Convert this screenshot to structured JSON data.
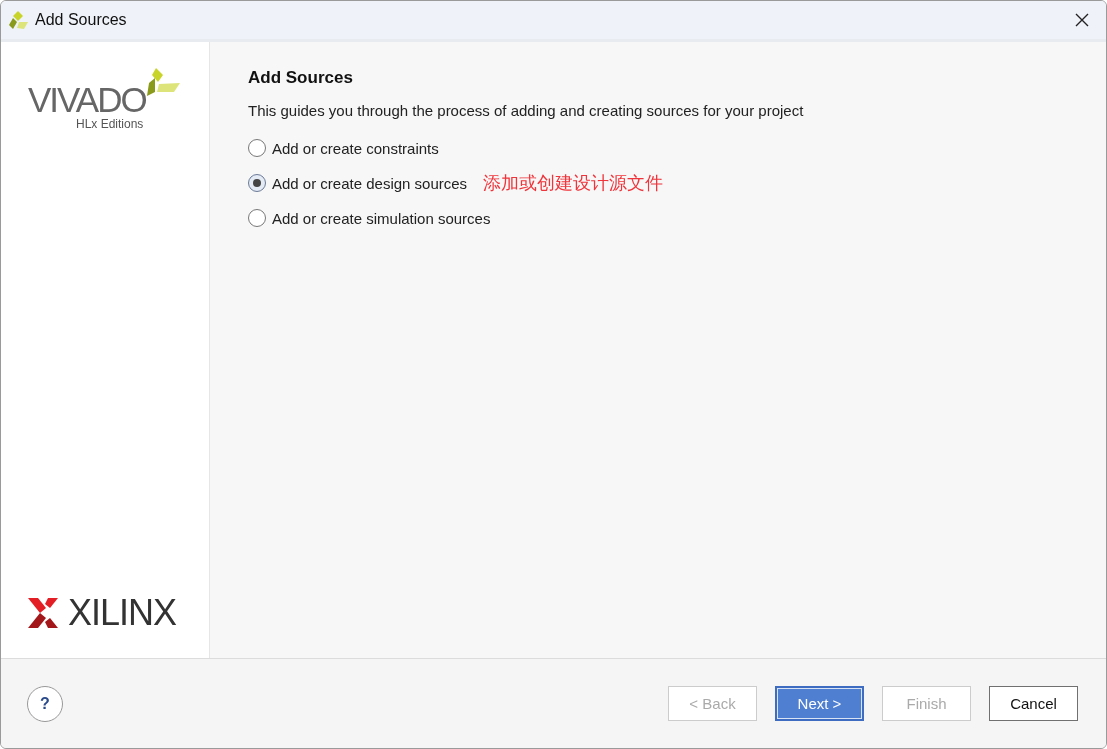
{
  "window": {
    "title": "Add Sources"
  },
  "sidebar": {
    "product": "VIVADO",
    "edition": "HLx Editions",
    "company": "XILINX"
  },
  "page": {
    "heading": "Add Sources",
    "description": "This guides you through the process of adding and creating sources for your project"
  },
  "options": [
    {
      "label": "Add or create constraints",
      "selected": false
    },
    {
      "label": "Add or create design sources",
      "selected": true,
      "annotation": "添加或创建设计源文件"
    },
    {
      "label": "Add or create simulation sources",
      "selected": false
    }
  ],
  "help": {
    "label": "?"
  },
  "buttons": [
    {
      "label": "< Back",
      "disabled": true,
      "default": false
    },
    {
      "label": "Next >",
      "disabled": false,
      "default": true
    },
    {
      "label": "Finish",
      "disabled": true,
      "default": false
    },
    {
      "label": "Cancel",
      "disabled": false,
      "default": false
    }
  ]
}
